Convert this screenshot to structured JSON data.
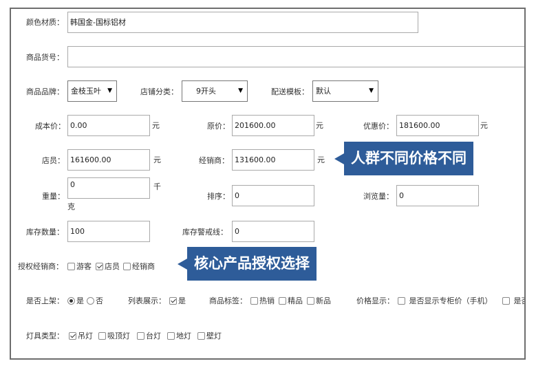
{
  "form": {
    "color_material": {
      "label": "颜色材质：",
      "value": "韩国金-国标铝材"
    },
    "product_code": {
      "label": "商品货号：",
      "value": ""
    },
    "brand": {
      "label": "商品品牌：",
      "value": "金枝玉叶"
    },
    "shop_category": {
      "label": "店铺分类：",
      "value": "9开头"
    },
    "delivery_template": {
      "label": "配送模板：",
      "value": "默认"
    },
    "cost_price": {
      "label": "成本价：",
      "value": "0.00",
      "unit": "元"
    },
    "original_price": {
      "label": "原价：",
      "value": "201600.00",
      "unit": "元"
    },
    "discount_price": {
      "label": "优惠价：",
      "value": "181600.00",
      "unit": "元"
    },
    "clerk_price": {
      "label": "店员：",
      "value": "161600.00",
      "unit": "元"
    },
    "dealer_price": {
      "label": "经销商：",
      "value": "131600.00",
      "unit": "元"
    },
    "weight": {
      "label": "重量：",
      "value": "0",
      "unit_line1": "千",
      "unit_line2": "克"
    },
    "sort": {
      "label": "排序：",
      "value": "0"
    },
    "views": {
      "label": "浏览量：",
      "value": "0"
    },
    "stock": {
      "label": "库存数量：",
      "value": "100"
    },
    "stock_warning": {
      "label": "库存警戒线：",
      "value": "0"
    },
    "auth_dealer": {
      "label": "授权经销商：",
      "options": [
        {
          "label": "游客",
          "checked": false
        },
        {
          "label": "店员",
          "checked": true
        },
        {
          "label": "经销商",
          "checked": false
        }
      ]
    },
    "listed": {
      "label": "是否上架：",
      "options": [
        {
          "label": "是",
          "checked": true
        },
        {
          "label": "否",
          "checked": false
        }
      ]
    },
    "list_display": {
      "label": "列表展示：",
      "option": "是",
      "checked": true
    },
    "product_tags": {
      "label": "商品标签：",
      "options": [
        {
          "label": "热销",
          "checked": false
        },
        {
          "label": "精品",
          "checked": false
        },
        {
          "label": "新品",
          "checked": false
        }
      ]
    },
    "price_display": {
      "label": "价格显示：",
      "option1": "是否显示专柜价（手机）",
      "option2": "是否"
    },
    "lamp_type": {
      "label": "灯具类型：",
      "options": [
        {
          "label": "吊灯",
          "checked": true
        },
        {
          "label": "吸顶灯",
          "checked": false
        },
        {
          "label": "台灯",
          "checked": false
        },
        {
          "label": "地灯",
          "checked": false
        },
        {
          "label": "壁灯",
          "checked": false
        }
      ]
    }
  },
  "callouts": {
    "price_callout": "人群不同价格不同",
    "auth_callout": "核心产品授权选择"
  },
  "colors": {
    "callout_bg": "#2e5c99",
    "border": "#6d6d6d"
  }
}
